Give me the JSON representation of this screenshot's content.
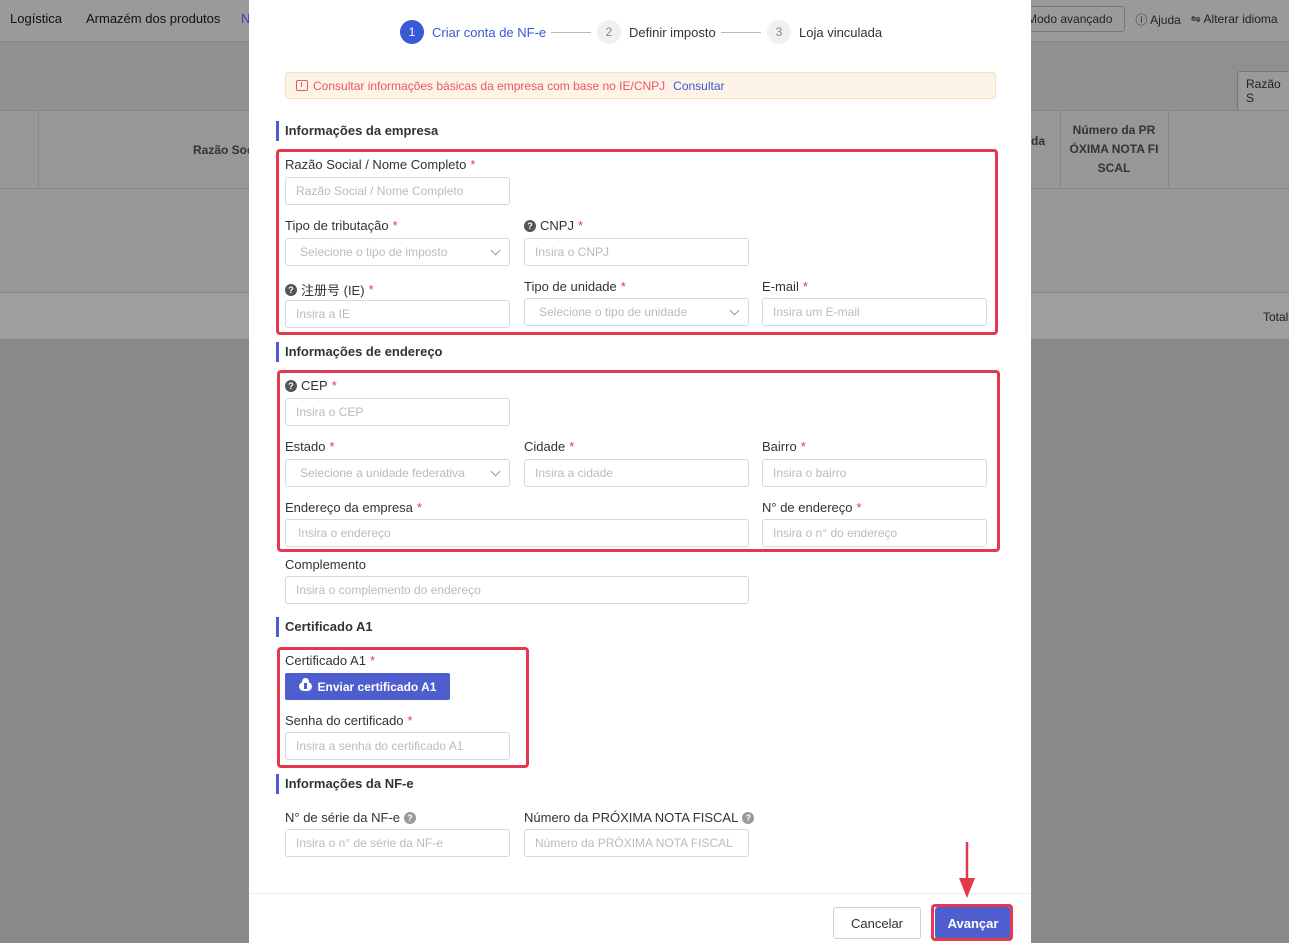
{
  "background": {
    "nav": [
      "Logística",
      "Armazém dos produtos",
      "N"
    ],
    "advanced_mode": "Modo avançado",
    "help": "Ajuda",
    "change_language": "Alterar idioma",
    "filter_partial": "Razão S",
    "col_razao": "Razão Soc",
    "col_partial": "da",
    "col_next_nf": "Número da PR ÓXIMA NOTA FI SCAL",
    "total": "Total"
  },
  "steps": [
    {
      "num": "1",
      "label": "Criar conta de NF-e"
    },
    {
      "num": "2",
      "label": "Definir imposto"
    },
    {
      "num": "3",
      "label": "Loja vinculada"
    }
  ],
  "notice": {
    "text": "Consultar informações básicas da empresa com base no IE/CNPJ",
    "link": "Consultar"
  },
  "sections": {
    "company": "Informações da empresa",
    "address": "Informações de endereço",
    "certificate": "Certificado A1",
    "nfe": "Informações da NF-e"
  },
  "fields": {
    "razao": {
      "label": "Razão Social / Nome Completo",
      "placeholder": "Razão Social / Nome Completo"
    },
    "tributacao": {
      "label": "Tipo de tributação",
      "placeholder": "Selecione o tipo de imposto"
    },
    "cnpj": {
      "label": "CNPJ",
      "placeholder": "Insira o CNPJ"
    },
    "ie": {
      "label": "注册号 (IE)",
      "placeholder": "Insira a IE"
    },
    "unidade": {
      "label": "Tipo de unidade",
      "placeholder": "Selecione o tipo de unidade"
    },
    "email": {
      "label": "E-mail",
      "placeholder": "Insira um E-mail"
    },
    "cep": {
      "label": "CEP",
      "placeholder": "Insira o CEP"
    },
    "estado": {
      "label": "Estado",
      "placeholder": "Selecione a unidade federativa"
    },
    "cidade": {
      "label": "Cidade",
      "placeholder": "Insira a cidade"
    },
    "bairro": {
      "label": "Bairro",
      "placeholder": "Insira o bairro"
    },
    "endereco": {
      "label": "Endereço da empresa",
      "placeholder": "Insira o endereço"
    },
    "numero": {
      "label": "N° de endereço",
      "placeholder": "Insira o n° do endereço"
    },
    "complemento": {
      "label": "Complemento",
      "placeholder": "Insira o complemento do endereço"
    },
    "certificado": {
      "label": "Certificado A1",
      "button": "Enviar certificado A1"
    },
    "senha": {
      "label": "Senha do certificado",
      "placeholder": "Insira a senha do certificado A1"
    },
    "serie": {
      "label": "N° de série da NF-e",
      "placeholder": "Insira o n° de série da NF-e"
    },
    "proxima": {
      "label": "Número da PRÓXIMA NOTA FISCAL",
      "placeholder": "Número da PRÓXIMA NOTA FISCAL"
    }
  },
  "required_mark": "*",
  "help_mark": "?",
  "footer": {
    "cancel": "Cancelar",
    "next": "Avançar"
  },
  "colors": {
    "primary": "#4f5ecf",
    "highlight": "#e5384f",
    "notice_text": "#e9566a"
  }
}
